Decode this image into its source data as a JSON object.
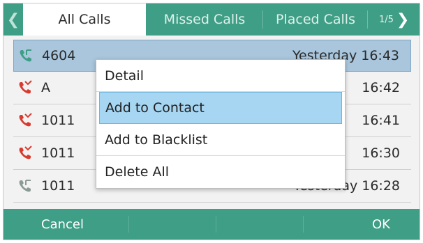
{
  "tabs": [
    {
      "label": "All Calls",
      "active": true
    },
    {
      "label": "Missed Calls",
      "active": false
    },
    {
      "label": "Placed Calls",
      "active": false
    }
  ],
  "pager": {
    "text": "1/5"
  },
  "calls": [
    {
      "number": "4604",
      "time": "Yesterday 16:43",
      "icon": "received-call-icon",
      "color": "#3f9e86"
    },
    {
      "number": "A",
      "time": "16:42",
      "icon": "missed-call-icon",
      "color": "#d83a2e"
    },
    {
      "number": "1011",
      "time": "16:41",
      "icon": "missed-call-icon",
      "color": "#d83a2e"
    },
    {
      "number": "1011",
      "time": "16:30",
      "icon": "missed-call-icon",
      "color": "#d83a2e"
    },
    {
      "number": "1011",
      "time": "Yesterday 16:28",
      "icon": "received-call-icon",
      "color": "#8a9a95"
    }
  ],
  "menu": {
    "items": [
      {
        "label": "Detail"
      },
      {
        "label": "Add to Contact"
      },
      {
        "label": "Add to Blacklist"
      },
      {
        "label": "Delete All"
      }
    ]
  },
  "softkeys": {
    "left": "Cancel",
    "right": "OK"
  },
  "colors": {
    "accent": "#3f9e86",
    "selected_row": "#a9c6dd",
    "menu_highlight": "#a6d6f2"
  }
}
